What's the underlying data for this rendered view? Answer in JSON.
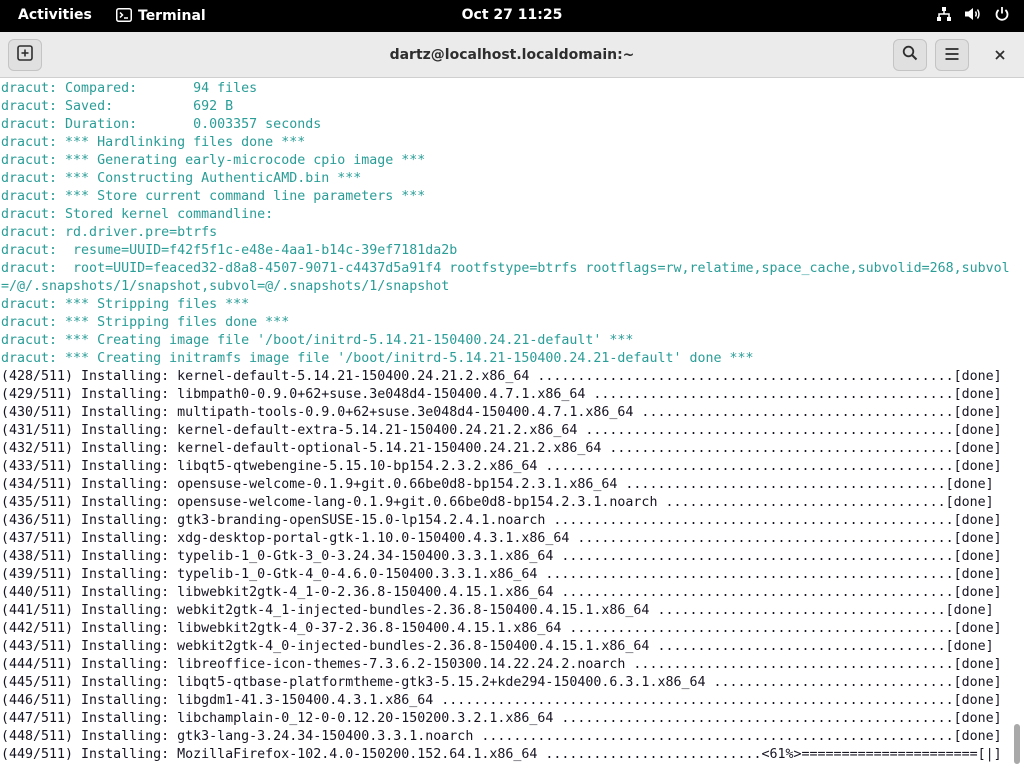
{
  "topbar": {
    "activities": "Activities",
    "app_name": "Terminal",
    "app_icon": "terminal-icon",
    "clock": "Oct 27  11:25",
    "tray_icons": [
      "network-icon",
      "volume-icon",
      "power-icon"
    ]
  },
  "window": {
    "title": "dartz@localhost.localdomain:~",
    "header_icons": [
      "new-tab-icon",
      "search-icon",
      "hamburger-menu-icon",
      "close-icon"
    ]
  },
  "terminal": {
    "dracut_color": "#2a9d97",
    "text_color": "#171421",
    "lines": [
      {
        "type": "dracut",
        "text": "dracut: Compared:       94 files"
      },
      {
        "type": "dracut",
        "text": "dracut: Saved:          692 B"
      },
      {
        "type": "dracut",
        "text": "dracut: Duration:       0.003357 seconds"
      },
      {
        "type": "dracut",
        "text": "dracut: *** Hardlinking files done ***"
      },
      {
        "type": "dracut",
        "text": "dracut: *** Generating early-microcode cpio image ***"
      },
      {
        "type": "dracut",
        "text": "dracut: *** Constructing AuthenticAMD.bin ***"
      },
      {
        "type": "dracut",
        "text": "dracut: *** Store current command line parameters ***"
      },
      {
        "type": "dracut",
        "text": "dracut: Stored kernel commandline:"
      },
      {
        "type": "dracut",
        "text": "dracut: rd.driver.pre=btrfs"
      },
      {
        "type": "dracut",
        "text": "dracut:  resume=UUID=f42f5f1c-e48e-4aa1-b14c-39ef7181da2b"
      },
      {
        "type": "dracut",
        "text": "dracut:  root=UUID=feaced32-d8a8-4507-9071-c4437d5a91f4 rootfstype=btrfs rootflags=rw,relatime,space_cache,subvolid=268,subvol"
      },
      {
        "type": "dracut",
        "text": "=/@/.snapshots/1/snapshot,subvol=@/.snapshots/1/snapshot"
      },
      {
        "type": "dracut",
        "text": "dracut: *** Stripping files ***"
      },
      {
        "type": "dracut",
        "text": "dracut: *** Stripping files done ***"
      },
      {
        "type": "dracut",
        "text": "dracut: *** Creating image file '/boot/initrd-5.14.21-150400.24.21-default' ***"
      },
      {
        "type": "dracut",
        "text": "dracut: *** Creating initramfs image file '/boot/initrd-5.14.21-150400.24.21-default' done ***"
      },
      {
        "type": "install",
        "text": "(428/511) Installing: kernel-default-5.14.21-150400.24.21.2.x86_64 ....................................................[done]"
      },
      {
        "type": "install",
        "text": "(429/511) Installing: libmpath0-0.9.0+62+suse.3e048d4-150400.4.7.1.x86_64 .............................................[done]"
      },
      {
        "type": "install",
        "text": "(430/511) Installing: multipath-tools-0.9.0+62+suse.3e048d4-150400.4.7.1.x86_64 .......................................[done]"
      },
      {
        "type": "install",
        "text": "(431/511) Installing: kernel-default-extra-5.14.21-150400.24.21.2.x86_64 ..............................................[done]"
      },
      {
        "type": "install",
        "text": "(432/511) Installing: kernel-default-optional-5.14.21-150400.24.21.2.x86_64 ...........................................[done]"
      },
      {
        "type": "install",
        "text": "(433/511) Installing: libqt5-qtwebengine-5.15.10-bp154.2.3.2.x86_64 ...................................................[done]"
      },
      {
        "type": "install",
        "text": "(434/511) Installing: opensuse-welcome-0.1.9+git.0.66be0d8-bp154.2.3.1.x86_64 ........................................[done]"
      },
      {
        "type": "install",
        "text": "(435/511) Installing: opensuse-welcome-lang-0.1.9+git.0.66be0d8-bp154.2.3.1.noarch ...................................[done]"
      },
      {
        "type": "install",
        "text": "(436/511) Installing: gtk3-branding-openSUSE-15.0-lp154.2.4.1.noarch ..................................................[done]"
      },
      {
        "type": "install",
        "text": "(437/511) Installing: xdg-desktop-portal-gtk-1.10.0-150400.4.3.1.x86_64 ...............................................[done]"
      },
      {
        "type": "install",
        "text": "(438/511) Installing: typelib-1_0-Gtk-3_0-3.24.34-150400.3.3.1.x86_64 .................................................[done]"
      },
      {
        "type": "install",
        "text": "(439/511) Installing: typelib-1_0-Gtk-4_0-4.6.0-150400.3.3.1.x86_64 ...................................................[done]"
      },
      {
        "type": "install",
        "text": "(440/511) Installing: libwebkit2gtk-4_1-0-2.36.8-150400.4.15.1.x86_64 .................................................[done]"
      },
      {
        "type": "install",
        "text": "(441/511) Installing: webkit2gtk-4_1-injected-bundles-2.36.8-150400.4.15.1.x86_64 ....................................[done]"
      },
      {
        "type": "install",
        "text": "(442/511) Installing: libwebkit2gtk-4_0-37-2.36.8-150400.4.15.1.x86_64 ................................................[done]"
      },
      {
        "type": "install",
        "text": "(443/511) Installing: webkit2gtk-4_0-injected-bundles-2.36.8-150400.4.15.1.x86_64 ....................................[done]"
      },
      {
        "type": "install",
        "text": "(444/511) Installing: libreoffice-icon-themes-7.3.6.2-150300.14.22.24.2.noarch ........................................[done]"
      },
      {
        "type": "install",
        "text": "(445/511) Installing: libqt5-qtbase-platformtheme-gtk3-5.15.2+kde294-150400.6.3.1.x86_64 ..............................[done]"
      },
      {
        "type": "install",
        "text": "(446/511) Installing: libgdm1-41.3-150400.4.3.1.x86_64 ................................................................[done]"
      },
      {
        "type": "install",
        "text": "(447/511) Installing: libchamplain-0_12-0-0.12.20-150200.3.2.1.x86_64 .................................................[done]"
      },
      {
        "type": "install",
        "text": "(448/511) Installing: gtk3-lang-3.24.34-150400.3.3.1.noarch ...........................................................[done]"
      },
      {
        "type": "install",
        "text": "(449/511) Installing: MozillaFirefox-102.4.0-150200.152.64.1.x86_64 ...........................<61%>======================[|]"
      }
    ]
  }
}
